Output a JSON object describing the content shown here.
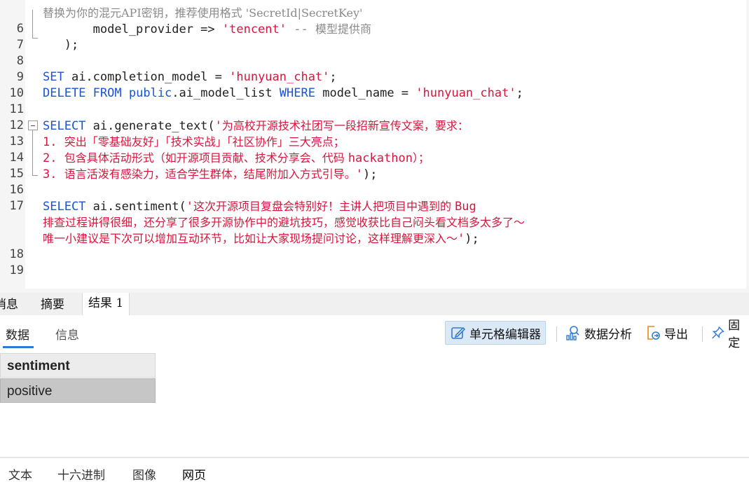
{
  "editor": {
    "lines": [
      {
        "num": "",
        "parts": [
          {
            "t": "替换为你的混元API密钥，推荐使用格式 'SecretId|SecretKey'",
            "c": "cmt cn"
          }
        ]
      },
      {
        "num": "6",
        "parts": [
          {
            "t": "       model_provider => ",
            "c": "plain"
          },
          {
            "t": "'tencent'",
            "c": "str"
          },
          {
            "t": " -- ",
            "c": "cmt"
          },
          {
            "t": "模型提供商",
            "c": "cmt cn"
          }
        ]
      },
      {
        "num": "7",
        "parts": [
          {
            "t": "   );",
            "c": "plain"
          }
        ]
      },
      {
        "num": "8",
        "parts": []
      },
      {
        "num": "9",
        "parts": [
          {
            "t": "SET",
            "c": "kw"
          },
          {
            "t": " ai.completion_model = ",
            "c": "plain"
          },
          {
            "t": "'hunyuan_chat'",
            "c": "str"
          },
          {
            "t": ";",
            "c": "plain"
          }
        ]
      },
      {
        "num": "10",
        "parts": [
          {
            "t": "DELETE FROM",
            "c": "kw"
          },
          {
            "t": " ",
            "c": "plain"
          },
          {
            "t": "public",
            "c": "kw"
          },
          {
            "t": ".ai_model_list ",
            "c": "plain"
          },
          {
            "t": "WHERE",
            "c": "kw"
          },
          {
            "t": " model_name = ",
            "c": "plain"
          },
          {
            "t": "'hunyuan_chat'",
            "c": "str"
          },
          {
            "t": ";",
            "c": "plain"
          }
        ]
      },
      {
        "num": "11",
        "parts": []
      },
      {
        "num": "12",
        "parts": [
          {
            "t": "SELECT",
            "c": "kw"
          },
          {
            "t": " ai.generate_text(",
            "c": "plain"
          },
          {
            "t": "'",
            "c": "str"
          },
          {
            "t": "为高校开源技术社团写一段招新宣传文案，要求：",
            "c": "str cn"
          }
        ]
      },
      {
        "num": "13",
        "parts": [
          {
            "t": "1. ",
            "c": "str"
          },
          {
            "t": "突出「零基础友好」「技术实战」「社区协作」三大亮点；",
            "c": "str cn"
          }
        ]
      },
      {
        "num": "14",
        "parts": [
          {
            "t": "2. ",
            "c": "str"
          },
          {
            "t": "包含具体活动形式（如开源项目贡献、技术分享会、代码 ",
            "c": "str cn"
          },
          {
            "t": "hackathon",
            "c": "str"
          },
          {
            "t": "）；",
            "c": "str cn"
          }
        ]
      },
      {
        "num": "15",
        "parts": [
          {
            "t": "3. ",
            "c": "str"
          },
          {
            "t": "语言活泼有感染力，适合学生群体，结尾附加入方式引导。",
            "c": "str cn"
          },
          {
            "t": "'",
            "c": "str"
          },
          {
            "t": ");",
            "c": "plain"
          }
        ]
      },
      {
        "num": "16",
        "parts": []
      },
      {
        "num": "17",
        "parts": [
          {
            "t": "SELECT",
            "c": "kw"
          },
          {
            "t": " ai.sentiment(",
            "c": "plain"
          },
          {
            "t": "'",
            "c": "str"
          },
          {
            "t": "这次开源项目复盘会特别好！主讲人把项目中遇到的 ",
            "c": "str cn"
          },
          {
            "t": "Bug",
            "c": "str"
          }
        ]
      },
      {
        "num": "",
        "parts": [
          {
            "t": "排查过程讲得很细，还分享了很多开源协作中的避坑技巧，感觉收获比自己闷头看文档多太多了～",
            "c": "str cn"
          }
        ]
      },
      {
        "num": "",
        "parts": [
          {
            "t": "唯一小建议是下次可以增加互动环节，比如让大家现场提问讨论，这样理解更深入～",
            "c": "str cn"
          },
          {
            "t": "'",
            "c": "str"
          },
          {
            "t": ");",
            "c": "plain"
          }
        ]
      },
      {
        "num": "18",
        "parts": []
      },
      {
        "num": "19",
        "parts": []
      }
    ]
  },
  "result_tabs": [
    "消息",
    "摘要",
    "结果 1"
  ],
  "sub_tabs": [
    "数据",
    "信息"
  ],
  "toolbar": {
    "cell_editor": "单元格编辑器",
    "data_analysis": "数据分析",
    "export": "导出",
    "pin": "固定"
  },
  "grid": {
    "column": "sentiment",
    "value": "positive"
  },
  "bottom_tabs": [
    "文本",
    "十六进制",
    "图像",
    "网页"
  ],
  "colors": {
    "keyword": "#1a53d6",
    "string": "#d6163c",
    "comment": "#8a8a8a",
    "accent": "#2f7ad6"
  }
}
